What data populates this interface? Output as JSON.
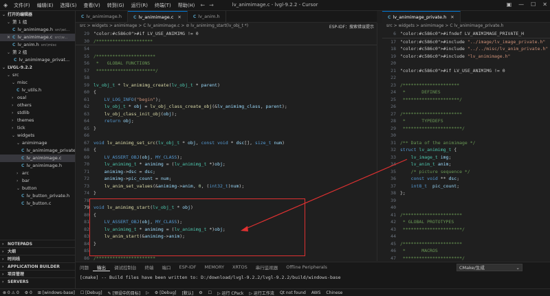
{
  "titlebar": {
    "menu": [
      "文件(F)",
      "编辑(E)",
      "选择(S)",
      "查看(V)",
      "转到(G)",
      "运行(R)",
      "终端(T)",
      "帮助(H)"
    ],
    "title": "lv_animimage.c - lvgl-9.2.2 - Cursor"
  },
  "sidebar": {
    "open_editors": "打开的编辑器",
    "group1": "第 1 组",
    "open_files": [
      {
        "name": "lv_animimage.h",
        "path": "src\\wi...",
        "selected": false
      },
      {
        "name": "lv_animimage.c",
        "path": "src\\w...",
        "selected": true
      },
      {
        "name": "lv_anim.h",
        "path": "src\\misc",
        "selected": false
      }
    ],
    "group2": "第 2 组",
    "group2_file": "lv_animimage_privat...",
    "project": "LVGL-9.2.2",
    "tree": [
      {
        "label": "src",
        "indent": 1,
        "kind": "folder-open"
      },
      {
        "label": "misc",
        "indent": 2,
        "kind": "folder-open"
      },
      {
        "label": "lv_utils.h",
        "indent": 3,
        "kind": "file"
      },
      {
        "label": "osal",
        "indent": 2,
        "kind": "folder"
      },
      {
        "label": "others",
        "indent": 2,
        "kind": "folder"
      },
      {
        "label": "stdlib",
        "indent": 2,
        "kind": "folder"
      },
      {
        "label": "themes",
        "indent": 2,
        "kind": "folder"
      },
      {
        "label": "tick",
        "indent": 2,
        "kind": "folder"
      },
      {
        "label": "widgets",
        "indent": 2,
        "kind": "folder-open"
      },
      {
        "label": "animimage",
        "indent": 3,
        "kind": "folder-open"
      },
      {
        "label": "lv_animimage_private.h",
        "indent": 4,
        "kind": "file"
      },
      {
        "label": "lv_animimage.c",
        "indent": 4,
        "kind": "file",
        "selected": true
      },
      {
        "label": "lv_animimage.h",
        "indent": 4,
        "kind": "file"
      },
      {
        "label": "arc",
        "indent": 3,
        "kind": "folder"
      },
      {
        "label": "bar",
        "indent": 3,
        "kind": "folder"
      },
      {
        "label": "button",
        "indent": 3,
        "kind": "folder-open"
      },
      {
        "label": "lv_button_private.h",
        "indent": 4,
        "kind": "file"
      },
      {
        "label": "lv_button.c",
        "indent": 4,
        "kind": "file"
      }
    ],
    "bottom_sections": [
      "NOTEPADS",
      "大纲",
      "时间线",
      "APPLICATION BUILDER",
      "项目管理",
      "SERVERS"
    ]
  },
  "tabs_left": [
    {
      "label": "lv_animimage.h",
      "active": false
    },
    {
      "label": "lv_animimage.c",
      "active": true
    },
    {
      "label": "lv_anim.h",
      "active": false
    }
  ],
  "tabs_right": [
    {
      "label": "lv_animimage_private.h",
      "active": true
    }
  ],
  "breadcrumb_left": "src > widgets > animimage > C lv_animimage.c > ⊘ lv_animimg_start(lv_obj_t *)",
  "breadcrumb_right": "src > widgets > animimage > C lv_animimage_private.h",
  "esp_idf_label": "ESP-IDF：搜索错误提示",
  "left_sticky": [
    {
      "n": "29",
      "text": "#if LV_USE_ANIMIMG != 0"
    },
    {
      "n": "30",
      "text": "/*********************"
    }
  ],
  "left_code": [
    {
      "n": "54",
      "text": ""
    },
    {
      "n": "55",
      "text": "/**********************"
    },
    {
      "n": "56",
      "text": " *   GLOBAL FUNCTIONS"
    },
    {
      "n": "57",
      "text": " **********************/"
    },
    {
      "n": "58",
      "text": ""
    },
    {
      "n": "59",
      "text": "lv_obj_t * lv_animimg_create(lv_obj_t * parent)"
    },
    {
      "n": "60",
      "text": "{"
    },
    {
      "n": "61",
      "text": "    LV_LOG_INFO(\"begin\");"
    },
    {
      "n": "62",
      "text": "    lv_obj_t * obj = lv_obj_class_create_obj(&lv_animimg_class, parent);"
    },
    {
      "n": "63",
      "text": "    lv_obj_class_init_obj(obj);"
    },
    {
      "n": "64",
      "text": "    return obj;"
    },
    {
      "n": "65",
      "text": "}"
    },
    {
      "n": "66",
      "text": ""
    },
    {
      "n": "67",
      "text": "void lv_animimg_set_src(lv_obj_t * obj, const void * dsc[], size_t num)"
    },
    {
      "n": "68",
      "text": "{"
    },
    {
      "n": "69",
      "text": "    LV_ASSERT_OBJ(obj, MY_CLASS);"
    },
    {
      "n": "70",
      "text": "    lv_animimg_t * animimg = (lv_animimg_t *)obj;"
    },
    {
      "n": "71",
      "text": "    animimg->dsc = dsc;"
    },
    {
      "n": "72",
      "text": "    animimg->pic_count = num;"
    },
    {
      "n": "73",
      "text": "    lv_anim_set_values(&animimg->anim, 0, (int32_t)num);"
    },
    {
      "n": "74",
      "text": "}"
    },
    {
      "n": "78",
      "text": ""
    },
    {
      "n": "79",
      "text": "void lv_animimg_start(lv_obj_t * obj)"
    },
    {
      "n": "80",
      "text": "{"
    },
    {
      "n": "81",
      "text": "    LV_ASSERT_OBJ(obj, MY_CLASS);"
    },
    {
      "n": "82",
      "text": "    lv_animimg_t * animimg = (lv_animimg_t *)obj;"
    },
    {
      "n": "83",
      "text": "    lv_anim_start(&animimg->anim);"
    },
    {
      "n": "84",
      "text": "}"
    },
    {
      "n": "85",
      "text": ""
    },
    {
      "n": "86",
      "text": "/**********************"
    }
  ],
  "right_sticky": [
    {
      "n": "6",
      "text": "#ifndef LV_ANIMIMAGE_PRIVATE_H"
    }
  ],
  "right_code": [
    {
      "n": "17",
      "text": "#include \"../image/lv_image_private.h\""
    },
    {
      "n": "18",
      "text": "#include \"../../misc/lv_anim_private.h\""
    },
    {
      "n": "19",
      "text": "#include \"lv_animimage.h\""
    },
    {
      "n": "20",
      "text": ""
    },
    {
      "n": "21",
      "text": "#if LV_USE_ANIMIMG != 0"
    },
    {
      "n": "22",
      "text": ""
    },
    {
      "n": "23",
      "text": "/*********************"
    },
    {
      "n": "24",
      "text": " *      DEFINES"
    },
    {
      "n": "25",
      "text": " *********************/"
    },
    {
      "n": "26",
      "text": ""
    },
    {
      "n": "27",
      "text": "/**********************"
    },
    {
      "n": "28",
      "text": " *      TYPEDEFS"
    },
    {
      "n": "29",
      "text": " **********************/"
    },
    {
      "n": "30",
      "text": ""
    },
    {
      "n": "31",
      "text": "/** Data of the animimage */"
    },
    {
      "n": "32",
      "text": "struct lv_animimg_t {"
    },
    {
      "n": "33",
      "text": "    lv_image_t img;"
    },
    {
      "n": "34",
      "text": "    lv_anim_t anim;"
    },
    {
      "n": "35",
      "text": "    /* picture sequence */"
    },
    {
      "n": "36",
      "text": "    const void ** dsc;"
    },
    {
      "n": "37",
      "text": "    int8_t  pic_count;"
    },
    {
      "n": "38",
      "text": "};"
    },
    {
      "n": "39",
      "text": ""
    },
    {
      "n": "40",
      "text": ""
    },
    {
      "n": "41",
      "text": "/**********************"
    },
    {
      "n": "42",
      "text": " * GLOBAL PROTOTYPES"
    },
    {
      "n": "43",
      "text": " **********************/"
    },
    {
      "n": "44",
      "text": ""
    },
    {
      "n": "45",
      "text": "/**********************"
    },
    {
      "n": "46",
      "text": " *      MACROS"
    },
    {
      "n": "47",
      "text": " **********************/"
    }
  ],
  "panel": {
    "tabs": [
      "问题",
      "输出",
      "调试控制台",
      "终端",
      "端口",
      "ESP-IDF",
      "MEMORY",
      "XRTOS",
      "串行监视器",
      "Offline Peripherals"
    ],
    "active_tab": 1,
    "select_value": "CMake/生成",
    "output": "[cmake] -- Build files have been written to: D:/download/lvgl-9.2.2/lvgl-9.2.2/build/windows-base"
  },
  "statusbar": {
    "items": [
      "⊗ 0 ⚠ 0",
      "⚙ 0",
      "⊞ [windows-base]",
      "☐ [Debug]",
      "✎ [预设中的目标]",
      "▷",
      "⚙ [Debug]",
      "[默认]",
      "⚙",
      "☐",
      "▷ 运行 CPack",
      "▷ 运行工作流",
      "Qt not found",
      "AWS",
      "Chinese"
    ]
  },
  "colors": {
    "keyword": "#569cd6",
    "type": "#4ec9b0",
    "function": "#dcdcaa",
    "string": "#ce9178",
    "comment": "#6a9955",
    "macro": "#c586c0",
    "variable": "#9cdcfe",
    "number": "#b5cea8",
    "annotation": "#e03131"
  }
}
